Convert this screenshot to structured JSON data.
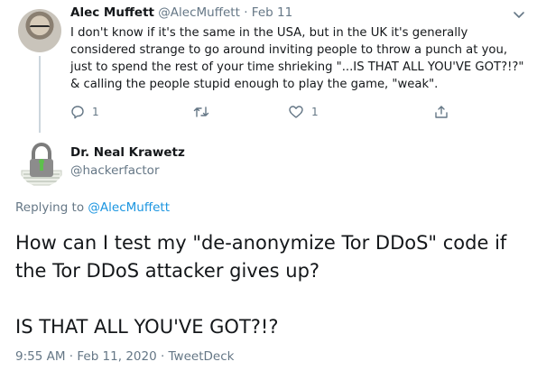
{
  "parent_tweet": {
    "display_name": "Alec Muffett",
    "handle": "@AlecMuffett",
    "separator": "·",
    "date": "Feb 11",
    "text": "I don't know if it's the same in the USA, but in the UK it's generally considered strange to go around inviting people to throw a punch at you, just to spend the rest of your time shrieking \"...IS THAT ALL YOU'VE GOT?!?\" & calling the people stupid enough to play the game, \"weak\".",
    "actions": {
      "reply_count": "1",
      "retweet_count": "",
      "like_count": "1"
    }
  },
  "main_tweet": {
    "display_name": "Dr. Neal Krawetz",
    "handle": "@hackerfactor",
    "replying_prefix": "Replying to",
    "replying_to": "@AlecMuffett",
    "text_paragraph_1": "How can I test my \"de-anonymize Tor DDoS\" code if the Tor DDoS attacker gives up?",
    "text_paragraph_2": "IS THAT ALL YOU'VE GOT?!?",
    "timestamp": "9:55 AM · Feb 11, 2020 · TweetDeck"
  },
  "icons": {
    "chevron": "chevron-down-icon",
    "reply": "reply-icon",
    "retweet": "retweet-icon",
    "like": "heart-icon",
    "share": "share-icon"
  },
  "colors": {
    "text": "#14171a",
    "muted": "#657786",
    "link": "#1b95e0",
    "thread_line": "#ccd6dd"
  }
}
